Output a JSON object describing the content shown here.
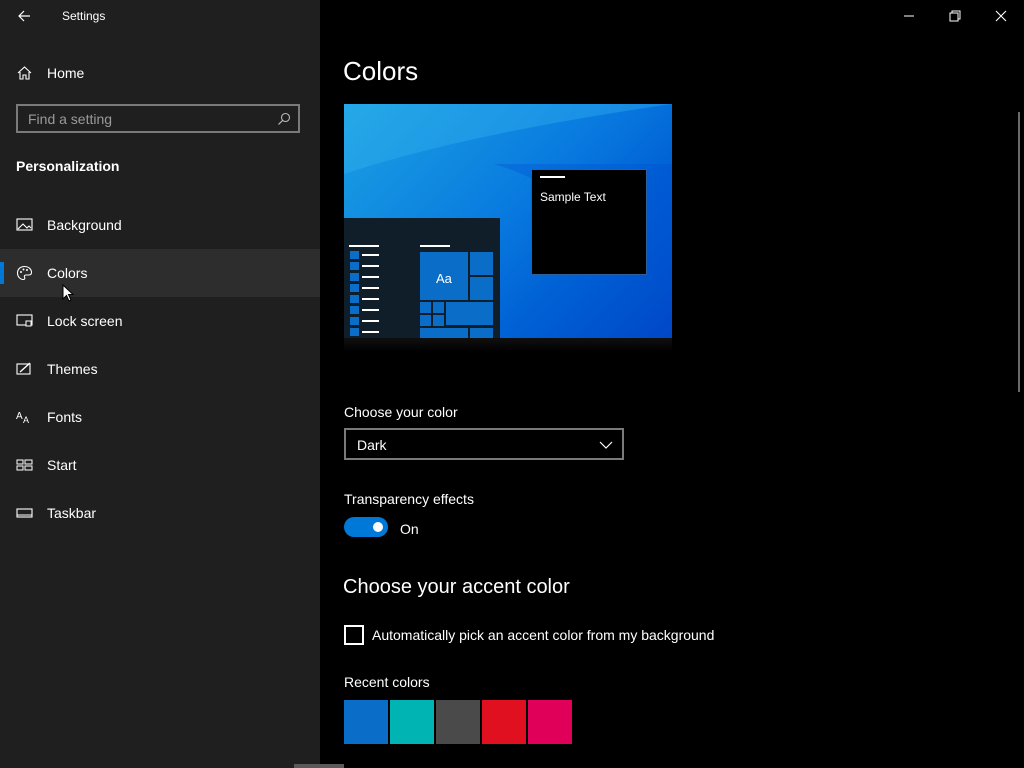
{
  "window": {
    "title": "Settings"
  },
  "sidebar": {
    "home_label": "Home",
    "search_placeholder": "Find a setting",
    "section": "Personalization",
    "items": [
      {
        "label": "Background",
        "icon": "picture-icon"
      },
      {
        "label": "Colors",
        "icon": "palette-icon",
        "selected": true
      },
      {
        "label": "Lock screen",
        "icon": "lock-screen-icon"
      },
      {
        "label": "Themes",
        "icon": "brush-icon"
      },
      {
        "label": "Fonts",
        "icon": "fonts-icon"
      },
      {
        "label": "Start",
        "icon": "start-icon"
      },
      {
        "label": "Taskbar",
        "icon": "taskbar-icon"
      }
    ]
  },
  "main": {
    "title": "Colors",
    "preview": {
      "sample_text": "Sample Text",
      "tile_text": "Aa"
    },
    "choose_color": {
      "label": "Choose your color",
      "value": "Dark"
    },
    "transparency": {
      "label": "Transparency effects",
      "state": "On"
    },
    "accent": {
      "heading": "Choose your accent color",
      "auto_label": "Automatically pick an accent color from my background",
      "auto_checked": false,
      "recent_label": "Recent colors",
      "recent_colors": [
        "#0a6ec8",
        "#00b4b4",
        "#4a4a4a",
        "#e01020",
        "#e0005a"
      ]
    }
  },
  "colors": {
    "accent": "#0078d7",
    "sidebar_bg": "#1f1f1f",
    "main_bg": "#000000"
  }
}
